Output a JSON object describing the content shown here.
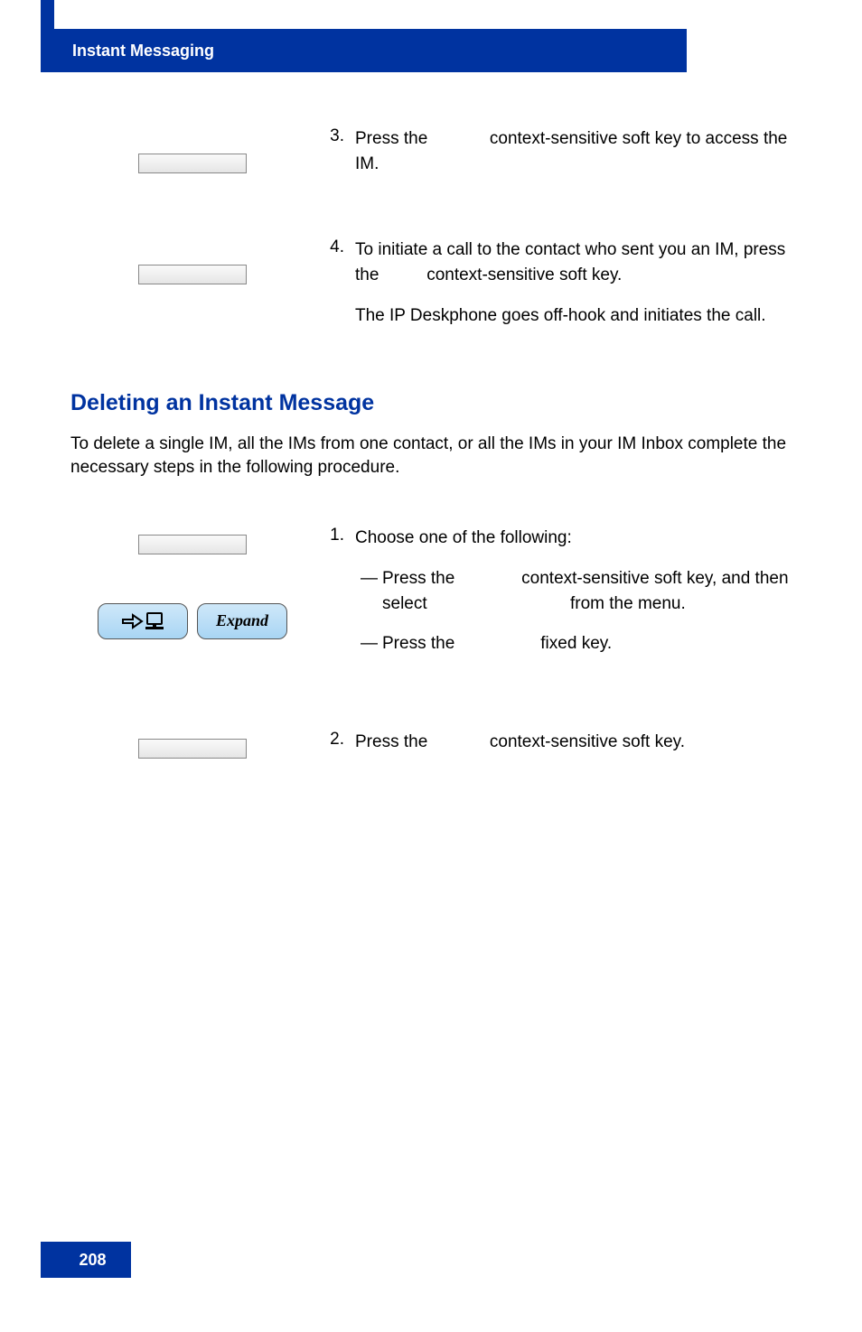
{
  "header": {
    "title": "Instant Messaging"
  },
  "steps_top": [
    {
      "num": "3.",
      "text": "Press the             context-sensitive soft key to access the IM."
    },
    {
      "num": "4.",
      "text": "To initiate a call to the contact who sent you an IM, press the          context-sensitive soft key.",
      "extra": "The IP Deskphone goes off-hook and initiates the call."
    }
  ],
  "section": {
    "heading": "Deleting an Instant Message",
    "intro": "To delete a single IM, all the IMs from one contact, or all the IMs in your IM Inbox complete the necessary steps in the following procedure."
  },
  "steps_bottom": [
    {
      "num": "1.",
      "text": "Choose one of the following:",
      "sub": [
        {
          "dash": "—",
          "text": "Press the              context-sensitive soft key, and then select                              from the menu."
        },
        {
          "dash": "—",
          "text": "Press the                  fixed key."
        }
      ]
    },
    {
      "num": "2.",
      "text": "Press the             context-sensitive soft key."
    }
  ],
  "buttons": {
    "expand_label": "Expand"
  },
  "footer": {
    "page": "208"
  }
}
